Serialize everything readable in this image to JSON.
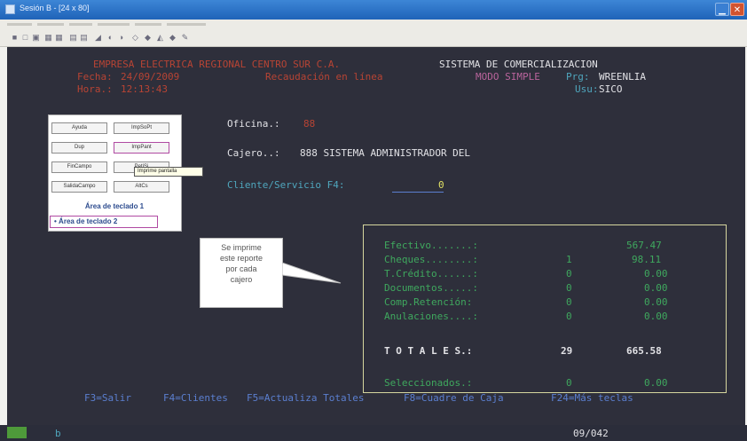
{
  "window": {
    "title": "Sesión B - [24 x 80]"
  },
  "header": {
    "company": "EMPRESA ELECTRICA REGIONAL CENTRO SUR C.A.",
    "system": "SISTEMA DE COMERCIALIZACION",
    "fecha_label": "Fecha:",
    "fecha": "24/09/2009",
    "module": "Recaudación en línea",
    "mode": "MODO SIMPLE",
    "prg_label": "Prg:",
    "prg": "WREENLIA",
    "hora_label": "Hora.:",
    "hora": "12:13:43",
    "usu_label": "Usu:",
    "usu": "SICO"
  },
  "form": {
    "oficina_label": "Oficina.:",
    "oficina": "88",
    "cajero_label": "Cajero..:",
    "cajero": "888 SISTEMA ADMINISTRADOR DEL",
    "cliente_label": "Cliente/Servicio F4:",
    "cliente_value": "0"
  },
  "keypad": {
    "buttons": [
      "Ayuda",
      "ImpSoPt",
      "Dup",
      "ImpPant",
      "FinCampo",
      "PetiSi",
      "SalidaCampo",
      "AltCs"
    ],
    "tooltip": "Imprime pantalla",
    "area1": "Área de teclado 1",
    "area2": "Área de teclado 2"
  },
  "callout": {
    "lines": [
      "Se imprime",
      "este reporte",
      "por cada",
      "cajero"
    ]
  },
  "totals": {
    "rows": [
      {
        "label": "Efectivo.......:",
        "count": "",
        "amount": "567.47"
      },
      {
        "label": "Cheques........:",
        "count": "1",
        "amount": "98.11"
      },
      {
        "label": "T.Crédito......:",
        "count": "0",
        "amount": "0.00"
      },
      {
        "label": "Documentos.....:",
        "count": "0",
        "amount": "0.00"
      },
      {
        "label": "Comp.Retención:",
        "count": "0",
        "amount": "0.00"
      },
      {
        "label": "Anulaciones....:",
        "count": "0",
        "amount": "0.00"
      }
    ],
    "total_label": "T O T A L E S.:",
    "total_count": "29",
    "total_amount": "665.58",
    "selected_label": "Seleccionados.:",
    "selected_count": "0",
    "selected_amount": "0.00"
  },
  "fkeys": [
    "F3=Salir",
    "F4=Clientes",
    "F5=Actualiza Totales",
    "F8=Cuadre de Caja",
    "F24=Más teclas"
  ],
  "status": {
    "cursor_char": "b",
    "position": "09/042"
  },
  "icons": [
    "app-icon",
    "minimize-icon",
    "close-icon"
  ]
}
